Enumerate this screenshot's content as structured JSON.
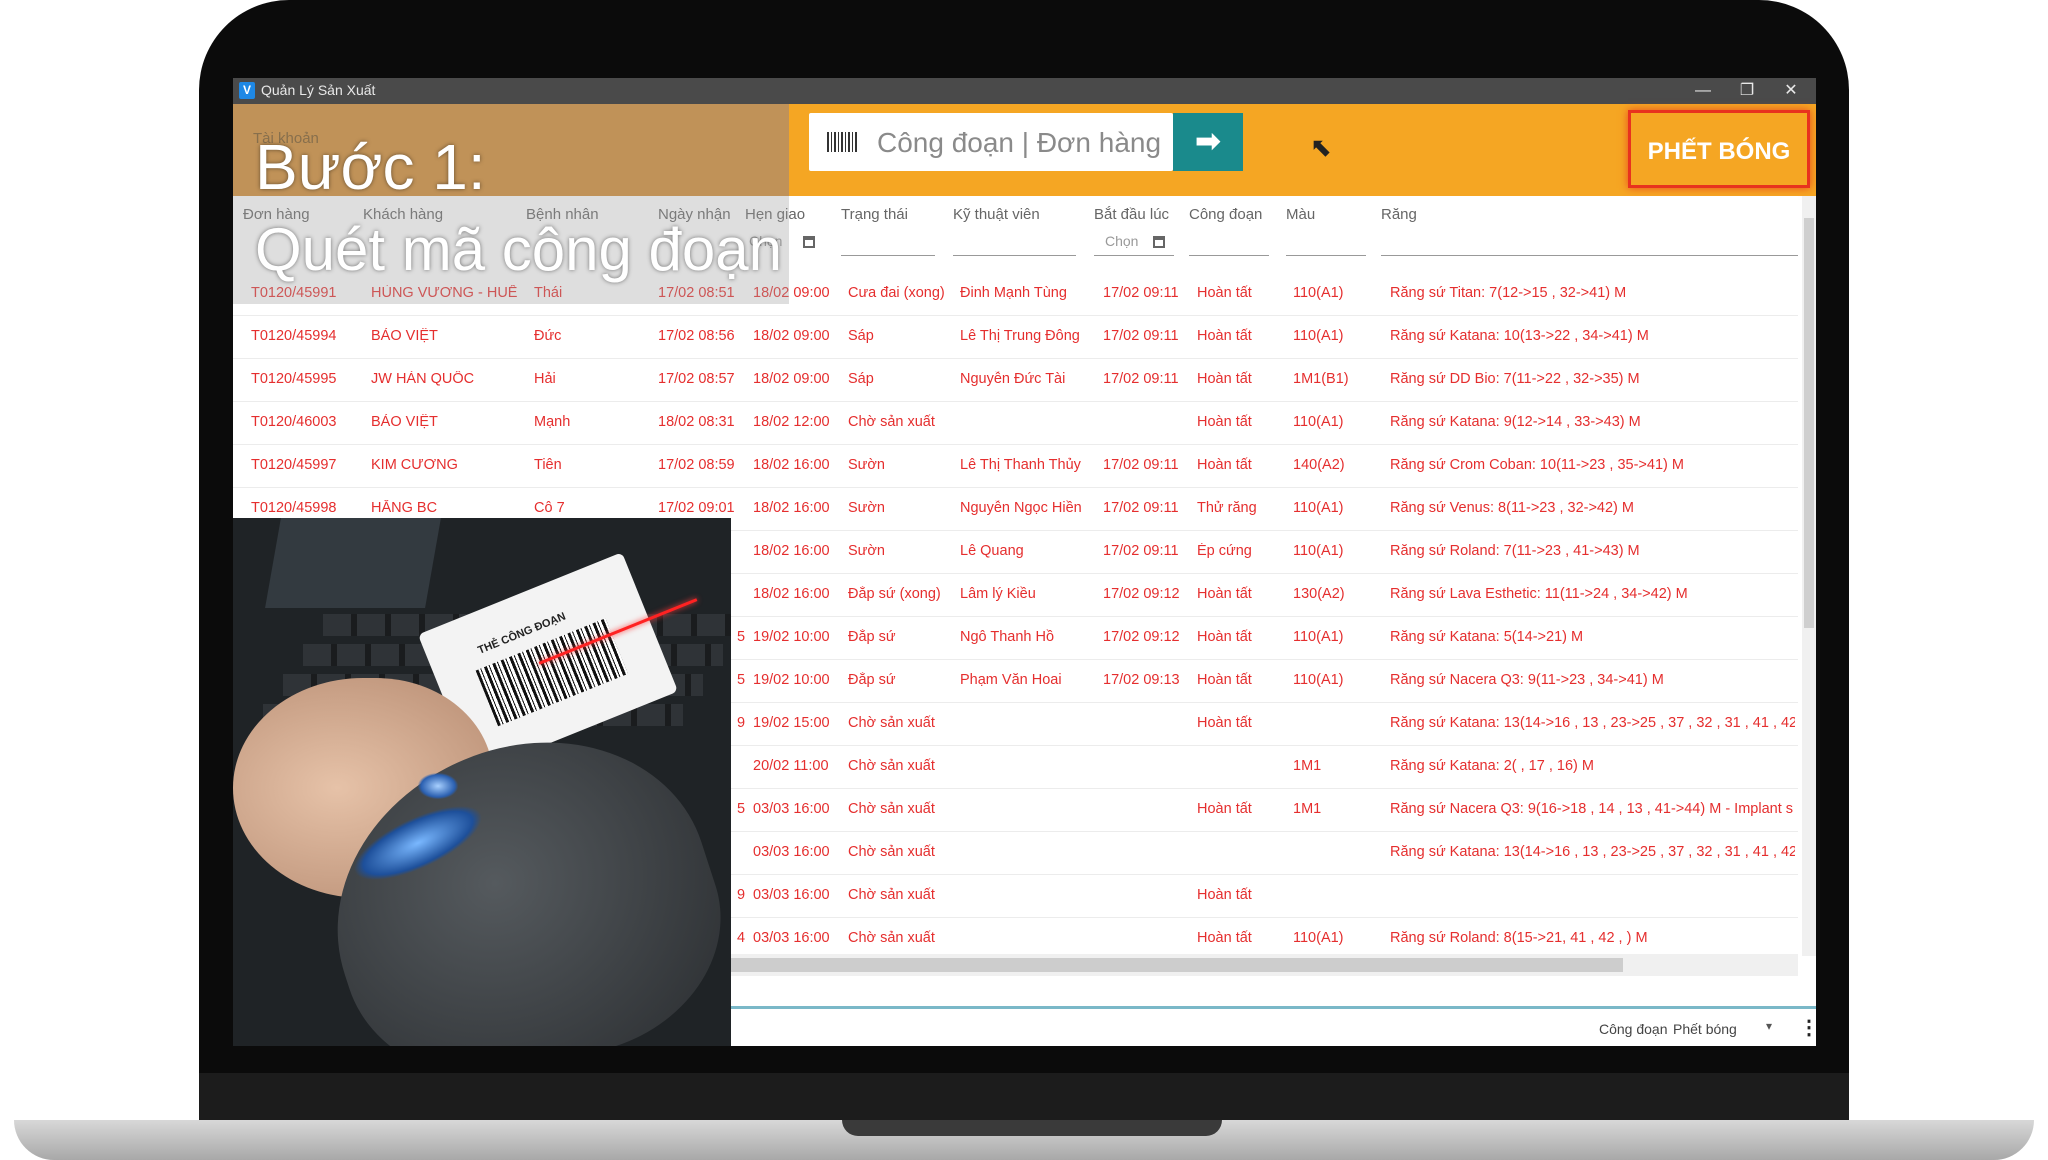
{
  "window": {
    "app_icon": "V",
    "title": "Quản Lý Sản Xuất",
    "minimize": "—",
    "restore": "❐",
    "close": "✕"
  },
  "header": {
    "user_text": "Tài khoản",
    "search_placeholder": "Công đoạn | Đơn hàng",
    "go_icon": "arrow-right-icon",
    "go_symbol": "➡",
    "stage_label": "PHẾT BÓNG"
  },
  "step": {
    "title": "Bước 1:",
    "subtitle": "Quét mã công đoạn"
  },
  "table": {
    "columns": [
      "Đơn hàng",
      "Khách hàng",
      "Bệnh nhân",
      "Ngày nhận",
      "Hẹn giao",
      "Trạng thái",
      "Kỹ thuật viên",
      "Bắt đầu lúc",
      "Công đoạn",
      "Màu",
      "Răng"
    ],
    "filter_placeholder_1": "Chọn",
    "filter_placeholder_2": "Chọn",
    "rows": [
      [
        "T0120/45991",
        "HÙNG VƯƠNG - HUẾ",
        "Thái",
        "17/02 08:51",
        "18/02 09:00",
        "Cưa đai (xong)",
        "Đinh Mạnh Tùng",
        "17/02 09:11",
        "Hoàn tất",
        "110(A1)",
        "Răng sứ Titan: 7(12->15 , 32->41) M"
      ],
      [
        "T0120/45994",
        "BẢO VIỆT",
        "Đức",
        "17/02 08:56",
        "18/02 09:00",
        "Sáp",
        "Lê Thị Trung Đông",
        "17/02 09:11",
        "Hoàn tất",
        "110(A1)",
        "Răng sứ Katana: 10(13->22 , 34->41) M"
      ],
      [
        "T0120/45995",
        "JW HÀN QUỐC",
        "Hải",
        "17/02 08:57",
        "18/02 09:00",
        "Sáp",
        "Nguyễn Đức Tài",
        "17/02 09:11",
        "Hoàn tất",
        "1M1(B1)",
        "Răng sứ DD Bio: 7(11->22 , 32->35) M"
      ],
      [
        "T0120/46003",
        "BẢO VIỆT",
        "Mạnh",
        "18/02 08:31",
        "18/02 12:00",
        "Chờ sản xuất",
        "",
        "",
        "Hoàn tất",
        "110(A1)",
        "Răng sứ Katana: 9(12->14 , 33->43) M"
      ],
      [
        "T0120/45997",
        "KIM CƯƠNG",
        "Tiên",
        "17/02 08:59",
        "18/02 16:00",
        "Sườn",
        "Lê Thị Thanh Thủy",
        "17/02 09:11",
        "Hoàn tất",
        "140(A2)",
        "Răng sứ Crom Coban: 10(11->23 , 35->41) M"
      ],
      [
        "T0120/45998",
        "HẰNG BC",
        "Cô 7",
        "17/02 09:01",
        "18/02 16:00",
        "Sườn",
        "Nguyễn Ngọc Hiền",
        "17/02 09:11",
        "Thử răng",
        "110(A1)",
        "Răng sứ Venus: 8(11->23 , 32->42) M"
      ],
      [
        "",
        "",
        "",
        "",
        "18/02 16:00",
        "Sườn",
        "Lê Quang",
        "17/02 09:11",
        "Ép cứng",
        "110(A1)",
        "Răng sứ Roland: 7(11->23 , 41->43) M"
      ],
      [
        "",
        "",
        "",
        "",
        "18/02 16:00",
        "Đắp sứ (xong)",
        "Lâm lý Kiều",
        "17/02 09:12",
        "Hoàn tất",
        "130(A2)",
        "Răng sứ Lava Esthetic: 11(11->24 , 34->42) M"
      ],
      [
        "",
        "",
        "",
        "5",
        "19/02 10:00",
        "Đắp sứ",
        "Ngô Thanh Hồ",
        "17/02 09:12",
        "Hoàn tất",
        "110(A1)",
        "Răng sứ Katana: 5(14->21) M"
      ],
      [
        "",
        "",
        "",
        "5",
        "19/02 10:00",
        "Đắp sứ",
        "Phạm Văn Hoai",
        "17/02 09:13",
        "Hoàn tất",
        "110(A1)",
        "Răng sứ Nacera Q3: 9(11->23 , 34->41) M"
      ],
      [
        "",
        "",
        "",
        "9",
        "19/02 15:00",
        "Chờ sản xuất",
        "",
        "",
        "Hoàn tất",
        "",
        "Răng sứ Katana: 13(14->16 , 13 , 23->25 , 37 , 32 , 31 , 41 , 42"
      ],
      [
        "",
        "",
        "",
        "",
        "20/02 11:00",
        "Chờ sản xuất",
        "",
        "",
        "",
        "1M1",
        "Răng sứ Katana: 2( , 17 , 16) M"
      ],
      [
        "",
        "",
        "",
        "5",
        "03/03 16:00",
        "Chờ sản xuất",
        "",
        "",
        "Hoàn tất",
        "1M1",
        "Răng sứ Nacera Q3: 9(16->18 , 14 , 13 , 41->44) M - Implant s"
      ],
      [
        "",
        "",
        "",
        "",
        "03/03 16:00",
        "Chờ sản xuất",
        "",
        "",
        "",
        "",
        "Răng sứ Katana: 13(14->16 , 13 , 23->25 , 37 , 32 , 31 , 41 , 42"
      ],
      [
        "",
        "",
        "",
        "9",
        "03/03 16:00",
        "Chờ sản xuất",
        "",
        "",
        "Hoàn tất",
        "",
        ""
      ],
      [
        "",
        "",
        "",
        "4",
        "03/03 16:00",
        "Chờ sản xuất",
        "",
        "",
        "Hoàn tất",
        "110(A1)",
        "Răng sứ Roland: 8(15->21, 41 , 42 , ) M"
      ]
    ]
  },
  "footer": {
    "label": "Công đoạn",
    "value": "Phết bóng",
    "arrow": "▾",
    "menu": "⋮"
  },
  "video": {
    "card_text": "THẺ CÔNG ĐOẠN"
  },
  "colors": {
    "header_orange": "#f5a623",
    "header_left": "#d18a32",
    "go_button": "#1a8a8c",
    "row_text": "#e52e2e",
    "highlight_border": "#e8321e"
  }
}
